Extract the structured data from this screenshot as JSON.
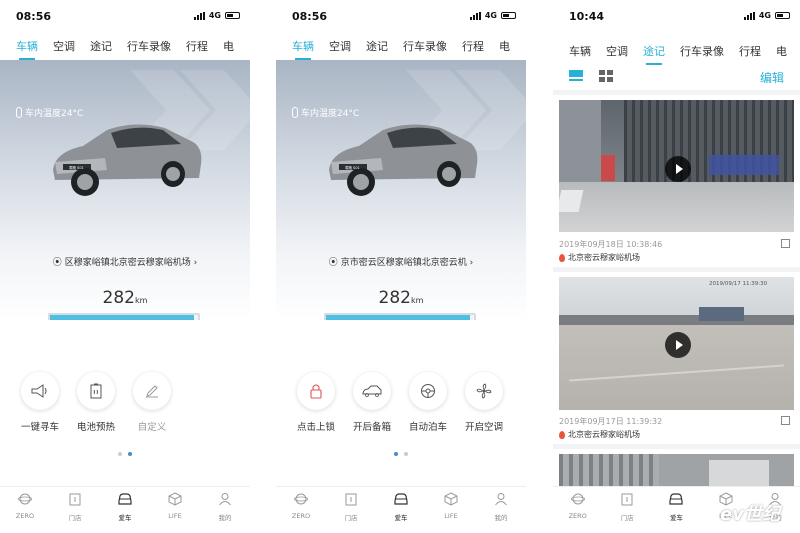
{
  "phones": [
    {
      "time": "08:56",
      "network": "4G",
      "tabs": [
        "车辆",
        "空调",
        "途记",
        "行车录像",
        "行程",
        "电"
      ],
      "active_tab": 0,
      "temperature": "车内温度24°C",
      "car_badge": "零跑 S01",
      "location": "区穆家峪镇北京密云穆家峪机场",
      "range_value": "282",
      "range_unit": "km",
      "battery_fill": 0.97,
      "actions": [
        {
          "label": "一键寻车",
          "icon": "horn-icon"
        },
        {
          "label": "电池预热",
          "icon": "battery-heat-icon"
        },
        {
          "label": "自定义",
          "icon": "pencil-icon"
        }
      ],
      "page_index": 1,
      "page_count": 2,
      "nav": [
        "ZERO",
        "门店",
        "爱车",
        "LIFE",
        "我的"
      ],
      "active_nav": 2
    },
    {
      "time": "08:56",
      "network": "4G",
      "tabs": [
        "车辆",
        "空调",
        "途记",
        "行车录像",
        "行程",
        "电"
      ],
      "active_tab": 0,
      "temperature": "车内温度24°C",
      "car_badge": "零跑 S01",
      "location": "京市密云区穆家峪镇北京密云机",
      "range_value": "282",
      "range_unit": "km",
      "battery_fill": 0.97,
      "actions": [
        {
          "label": "点击上锁",
          "icon": "lock-icon"
        },
        {
          "label": "开后备箱",
          "icon": "trunk-icon"
        },
        {
          "label": "自动泊车",
          "icon": "steering-wheel-icon"
        },
        {
          "label": "开启空调",
          "icon": "fan-icon"
        }
      ],
      "page_index": 0,
      "page_count": 2,
      "nav": [
        "ZERO",
        "门店",
        "爱车",
        "LIFE",
        "我的"
      ],
      "active_nav": 2
    },
    {
      "time": "10:44",
      "network": "4G",
      "tabs": [
        "车辆",
        "空调",
        "途记",
        "行车录像",
        "行程",
        "电"
      ],
      "active_tab": 2,
      "edit_label": "编辑",
      "videos": [
        {
          "date": "2019年09月18日 10:38:46",
          "location": "北京密云穆家峪机场",
          "overlay": ""
        },
        {
          "date": "2019年09月17日 11:39:32",
          "location": "北京密云穆家峪机场",
          "overlay": "2019/09/17 11:39:30"
        }
      ],
      "nav": [
        "ZERO",
        "门店",
        "爱车",
        "LIFE",
        "我的"
      ],
      "active_nav": 2
    }
  ],
  "watermark": "ev世纪",
  "colors": {
    "accent": "#28b0d6",
    "battery": "#4ebfe0",
    "pin": "#e8553b"
  }
}
